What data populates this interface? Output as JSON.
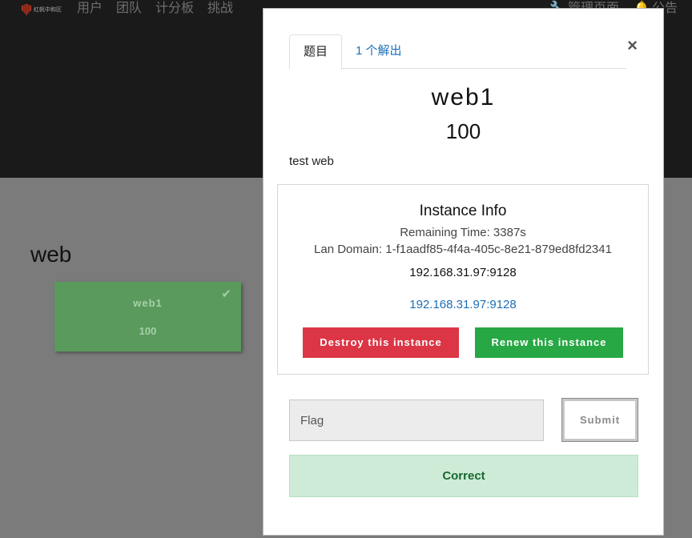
{
  "navbar": {
    "logo_text": "红帆中和区",
    "links": [
      "用户",
      "团队",
      "计分板",
      "挑战"
    ],
    "right_links": [
      {
        "icon": "wrench-icon",
        "label": "管理页面"
      },
      {
        "icon": "bell-icon",
        "label": "公告"
      }
    ]
  },
  "board": {
    "category": "web",
    "card": {
      "name": "web1",
      "value": "100",
      "solved_icon": "check-icon"
    }
  },
  "modal": {
    "tabs": {
      "challenge": "题目",
      "solves": "1 个解出"
    },
    "close": "×",
    "name": "web1",
    "value": "100",
    "description": "test web",
    "instance": {
      "title": "Instance Info",
      "remaining": "Remaining Time: 3387s",
      "domain": "Lan Domain: 1-f1aadf85-4f4a-405c-8e21-879ed8fd2341",
      "address": "192.168.31.97:9128",
      "link": "192.168.31.97:9128",
      "destroy_label": "Destroy this instance",
      "renew_label": "Renew this instance"
    },
    "flag": {
      "placeholder": "Flag",
      "value": ""
    },
    "submit_label": "Submit",
    "result": "Correct"
  },
  "colors": {
    "destroy": "#dc3545",
    "renew": "#28a745",
    "link": "#1d6fb7",
    "success_bg": "#cdebd6",
    "solved_card": "#5a9a5d"
  }
}
